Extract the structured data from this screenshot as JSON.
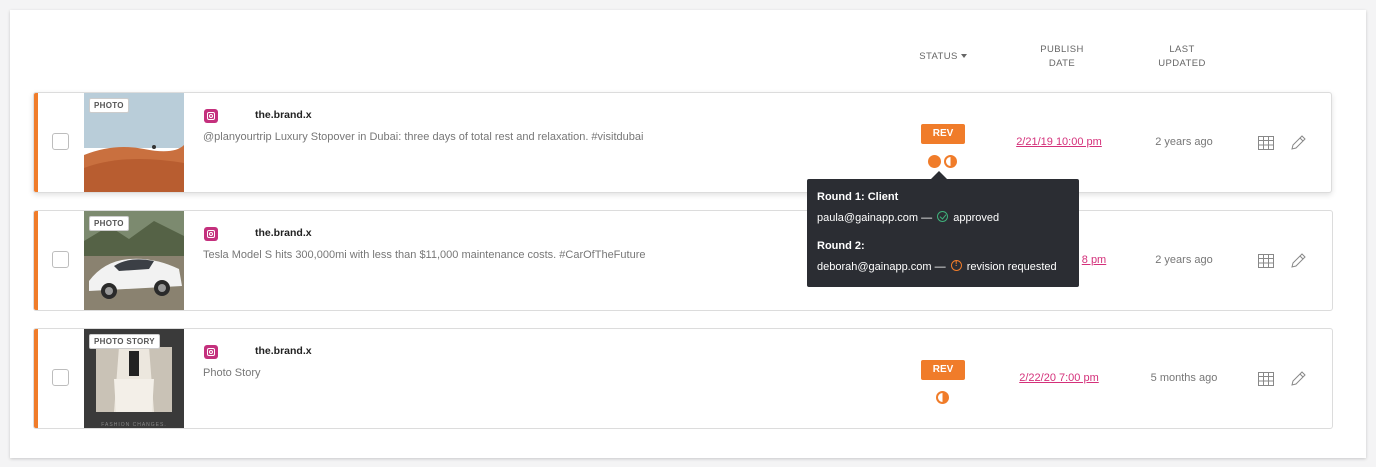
{
  "columns": {
    "status": "STATUS",
    "publish_date_line1": "PUBLISH",
    "publish_date_line2": "DATE",
    "last_updated_line1": "LAST",
    "last_updated_line2": "UPDATED"
  },
  "posts": [
    {
      "media_type": "PHOTO",
      "network_icon": "instagram-icon",
      "brand": "the.brand.x",
      "caption": "@planyourtrip Luxury Stopover in Dubai: three days of total rest and relaxation. #visitdubai",
      "status_label": "REV",
      "status_color": "#f07c2a",
      "publish_date": "2/21/19 10:00 pm",
      "last_updated": "2 years ago"
    },
    {
      "media_type": "PHOTO",
      "network_icon": "instagram-icon",
      "brand": "the.brand.x",
      "caption": "Tesla Model S hits 300,000mi with less than $11,000 maintenance costs. #CarOfTheFuture",
      "publish_date_visible": "8 pm",
      "last_updated": "2 years ago"
    },
    {
      "media_type": "PHOTO STORY",
      "network_icon": "instagram-icon",
      "brand": "the.brand.x",
      "caption": "Photo Story",
      "status_label": "REV",
      "publish_date": "2/22/20 7:00 pm",
      "last_updated": "5 months ago",
      "thumb_text": "FASHION CHANGES."
    }
  ],
  "tooltip": {
    "round1_title": "Round 1: Client",
    "round1_email": "paula@gainapp.com",
    "round1_sep": "—",
    "round1_status": "approved",
    "round2_title": "Round 2:",
    "round2_email": "deborah@gainapp.com",
    "round2_sep": "—",
    "round2_status": "revision requested"
  },
  "colors": {
    "accent": "#f07c2a",
    "link": "#d4307a",
    "approved": "#3fb07a",
    "tooltip_bg": "#2b2d33"
  }
}
